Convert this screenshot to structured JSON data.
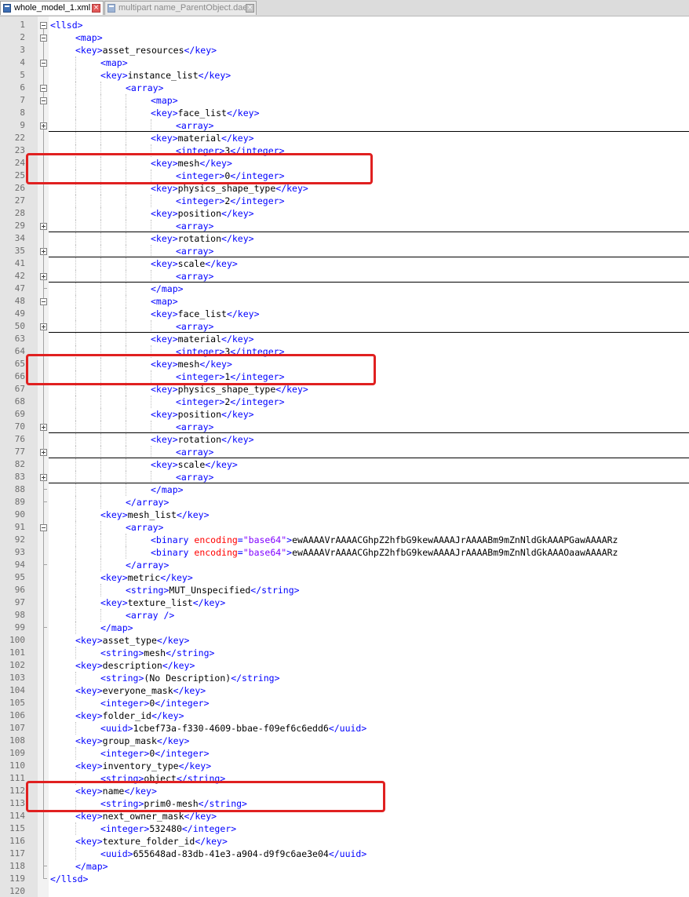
{
  "tabs": [
    {
      "label": "whole_model_1.xml",
      "active": true,
      "icon": "xml-file-icon"
    },
    {
      "label": "multipart name_ParentObject.dae",
      "active": false,
      "icon": "dae-file-icon"
    }
  ],
  "colors": {
    "tag": "#0000ff",
    "attribute": "#ff0000",
    "attribute_value": "#8000ff",
    "text": "#000000",
    "highlight": "#e02020"
  },
  "lines": [
    {
      "n": "1",
      "d": 0,
      "f": "minus",
      "t": "<llsd>"
    },
    {
      "n": "2",
      "d": 1,
      "f": "minus",
      "t": "<map>"
    },
    {
      "n": "3",
      "d": 1,
      "f": "line",
      "t": "<key>asset_resources</key>"
    },
    {
      "n": "4",
      "d": 2,
      "f": "minus",
      "t": "<map>"
    },
    {
      "n": "5",
      "d": 2,
      "f": "line",
      "t": "<key>instance_list</key>"
    },
    {
      "n": "6",
      "d": 3,
      "f": "minus",
      "t": "<array>"
    },
    {
      "n": "7",
      "d": 4,
      "f": "minus",
      "t": "<map>"
    },
    {
      "n": "8",
      "d": 4,
      "f": "line",
      "t": "<key>face_list</key>"
    },
    {
      "n": "9",
      "d": 5,
      "f": "plus",
      "t": "<array>"
    },
    {
      "n": "22",
      "d": 4,
      "f": "line",
      "t": "<key>material</key>"
    },
    {
      "n": "23",
      "d": 5,
      "f": "line",
      "t": "<integer>3</integer>"
    },
    {
      "n": "24",
      "d": 4,
      "f": "line",
      "t": "<key>mesh</key>"
    },
    {
      "n": "25",
      "d": 5,
      "f": "line",
      "t": "<integer>0</integer>"
    },
    {
      "n": "26",
      "d": 4,
      "f": "line",
      "t": "<key>physics_shape_type</key>"
    },
    {
      "n": "27",
      "d": 5,
      "f": "line",
      "t": "<integer>2</integer>"
    },
    {
      "n": "28",
      "d": 4,
      "f": "line",
      "t": "<key>position</key>"
    },
    {
      "n": "29",
      "d": 5,
      "f": "plus",
      "t": "<array>"
    },
    {
      "n": "34",
      "d": 4,
      "f": "line",
      "t": "<key>rotation</key>"
    },
    {
      "n": "35",
      "d": 5,
      "f": "plus",
      "t": "<array>"
    },
    {
      "n": "41",
      "d": 4,
      "f": "line",
      "t": "<key>scale</key>"
    },
    {
      "n": "42",
      "d": 5,
      "f": "plus",
      "t": "<array>"
    },
    {
      "n": "47",
      "d": 4,
      "f": "end",
      "t": "</map>"
    },
    {
      "n": "48",
      "d": 4,
      "f": "minus",
      "t": "<map>"
    },
    {
      "n": "49",
      "d": 4,
      "f": "line",
      "t": "<key>face_list</key>"
    },
    {
      "n": "50",
      "d": 5,
      "f": "plus",
      "t": "<array>"
    },
    {
      "n": "63",
      "d": 4,
      "f": "line",
      "t": "<key>material</key>"
    },
    {
      "n": "64",
      "d": 5,
      "f": "line",
      "t": "<integer>3</integer>"
    },
    {
      "n": "65",
      "d": 4,
      "f": "line",
      "t": "<key>mesh</key>"
    },
    {
      "n": "66",
      "d": 5,
      "f": "line",
      "t": "<integer>1</integer>"
    },
    {
      "n": "67",
      "d": 4,
      "f": "line",
      "t": "<key>physics_shape_type</key>"
    },
    {
      "n": "68",
      "d": 5,
      "f": "line",
      "t": "<integer>2</integer>"
    },
    {
      "n": "69",
      "d": 4,
      "f": "line",
      "t": "<key>position</key>"
    },
    {
      "n": "70",
      "d": 5,
      "f": "plus",
      "t": "<array>"
    },
    {
      "n": "76",
      "d": 4,
      "f": "line",
      "t": "<key>rotation</key>"
    },
    {
      "n": "77",
      "d": 5,
      "f": "plus",
      "t": "<array>"
    },
    {
      "n": "82",
      "d": 4,
      "f": "line",
      "t": "<key>scale</key>"
    },
    {
      "n": "83",
      "d": 5,
      "f": "plus",
      "t": "<array>"
    },
    {
      "n": "88",
      "d": 4,
      "f": "end",
      "t": "</map>"
    },
    {
      "n": "89",
      "d": 3,
      "f": "end",
      "t": "</array>"
    },
    {
      "n": "90",
      "d": 2,
      "f": "line",
      "t": "<key>mesh_list</key>"
    },
    {
      "n": "91",
      "d": 3,
      "f": "minus",
      "t": "<array>"
    },
    {
      "n": "92",
      "d": 4,
      "f": "line",
      "t": "<binary encoding=\"base64\">ewAAAAVrAAAACGhpZ2hfbG9kewAAAAJrAAAABm9mZnNldGkAAAPGawAAAARz"
    },
    {
      "n": "93",
      "d": 4,
      "f": "line",
      "t": "<binary encoding=\"base64\">ewAAAAVrAAAACGhpZ2hfbG9kewAAAAJrAAAABm9mZnNldGkAAAOaawAAAARz"
    },
    {
      "n": "94",
      "d": 3,
      "f": "end",
      "t": "</array>"
    },
    {
      "n": "95",
      "d": 2,
      "f": "line",
      "t": "<key>metric</key>"
    },
    {
      "n": "96",
      "d": 3,
      "f": "line",
      "t": "<string>MUT_Unspecified</string>"
    },
    {
      "n": "97",
      "d": 2,
      "f": "line",
      "t": "<key>texture_list</key>"
    },
    {
      "n": "98",
      "d": 3,
      "f": "line",
      "t": "<array />"
    },
    {
      "n": "99",
      "d": 2,
      "f": "end",
      "t": "</map>"
    },
    {
      "n": "100",
      "d": 1,
      "f": "line",
      "t": "<key>asset_type</key>"
    },
    {
      "n": "101",
      "d": 2,
      "f": "line",
      "t": "<string>mesh</string>"
    },
    {
      "n": "102",
      "d": 1,
      "f": "line",
      "t": "<key>description</key>"
    },
    {
      "n": "103",
      "d": 2,
      "f": "line",
      "t": "<string>(No Description)</string>"
    },
    {
      "n": "104",
      "d": 1,
      "f": "line",
      "t": "<key>everyone_mask</key>"
    },
    {
      "n": "105",
      "d": 2,
      "f": "line",
      "t": "<integer>0</integer>"
    },
    {
      "n": "106",
      "d": 1,
      "f": "line",
      "t": "<key>folder_id</key>"
    },
    {
      "n": "107",
      "d": 2,
      "f": "line",
      "t": "<uuid>1cbef73a-f330-4609-bbae-f09ef6c6edd6</uuid>"
    },
    {
      "n": "108",
      "d": 1,
      "f": "line",
      "t": "<key>group_mask</key>"
    },
    {
      "n": "109",
      "d": 2,
      "f": "line",
      "t": "<integer>0</integer>"
    },
    {
      "n": "110",
      "d": 1,
      "f": "line",
      "t": "<key>inventory_type</key>"
    },
    {
      "n": "111",
      "d": 2,
      "f": "line",
      "t": "<string>object</string>"
    },
    {
      "n": "112",
      "d": 1,
      "f": "line",
      "t": "<key>name</key>"
    },
    {
      "n": "113",
      "d": 2,
      "f": "line",
      "t": "<string>prim0-mesh</string>"
    },
    {
      "n": "114",
      "d": 1,
      "f": "line",
      "t": "<key>next_owner_mask</key>"
    },
    {
      "n": "115",
      "d": 2,
      "f": "line",
      "t": "<integer>532480</integer>"
    },
    {
      "n": "116",
      "d": 1,
      "f": "line",
      "t": "<key>texture_folder_id</key>"
    },
    {
      "n": "117",
      "d": 2,
      "f": "line",
      "t": "<uuid>655648ad-83db-41e3-a904-d9f9c6ae3e04</uuid>"
    },
    {
      "n": "118",
      "d": 1,
      "f": "end",
      "t": "</map>"
    },
    {
      "n": "119",
      "d": 0,
      "f": "end",
      "t": "</llsd>"
    },
    {
      "n": "120",
      "d": 0,
      "f": "none",
      "t": ""
    }
  ],
  "highlights": [
    {
      "from": "24",
      "to": "25"
    },
    {
      "from": "65",
      "to": "66"
    },
    {
      "from": "112",
      "to": "113"
    }
  ]
}
